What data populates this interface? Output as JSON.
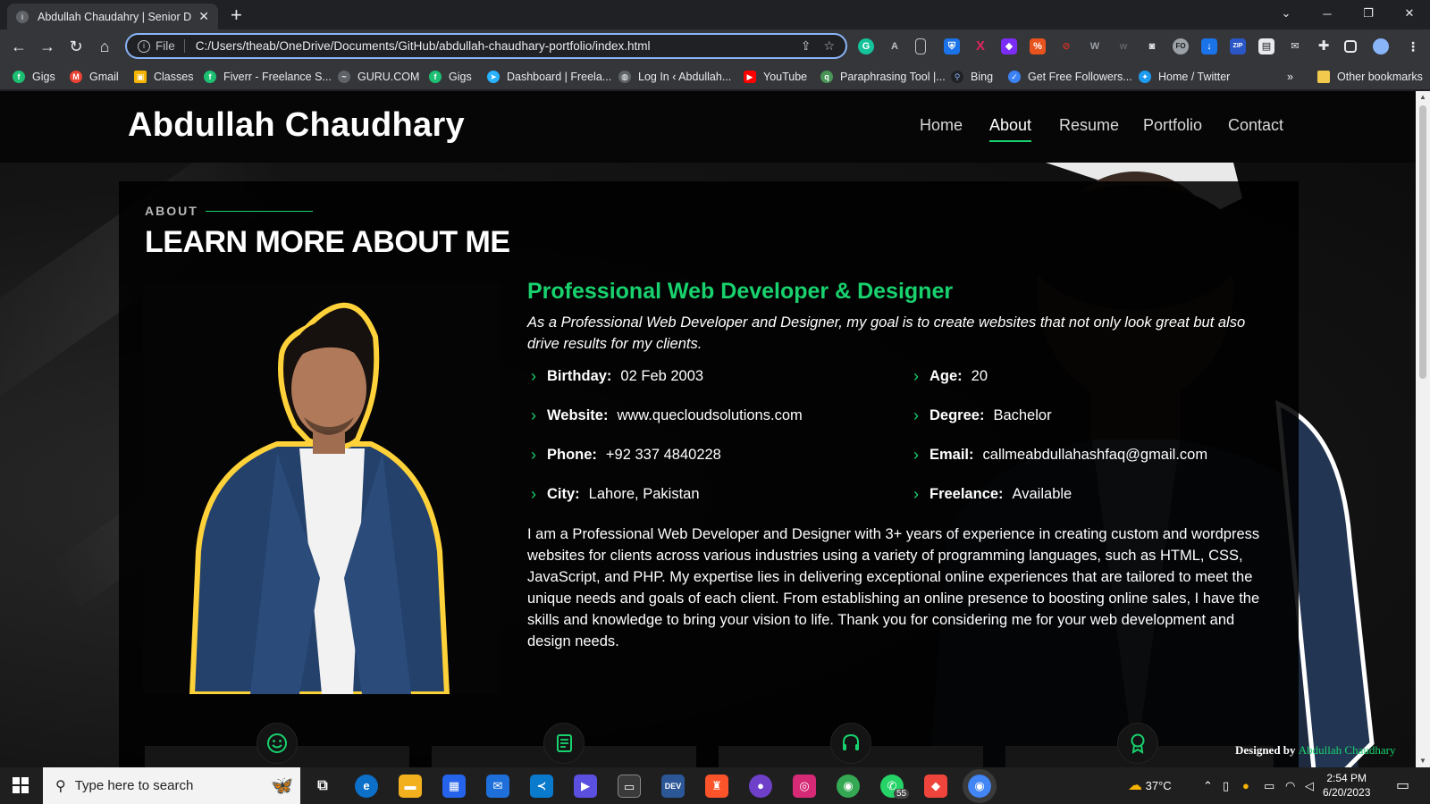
{
  "browser": {
    "tab_title": "Abdullah Chaudahry | Senior Dev",
    "address_scheme": "File",
    "address_url": "C:/Users/theab/OneDrive/Documents/GitHub/abdullah-chaudhary-portfolio/index.html",
    "bookmarks": [
      {
        "label": "Gigs",
        "icon": "fiverr-icon",
        "color": "#1dbf73"
      },
      {
        "label": "Gmail",
        "icon": "gmail-icon",
        "color": "#ea4335"
      },
      {
        "label": "Classes",
        "icon": "classroom-icon",
        "color": "#f4b400"
      },
      {
        "label": "Fiverr - Freelance S...",
        "icon": "fiverr-icon",
        "color": "#1dbf73"
      },
      {
        "label": "GURU.COM",
        "icon": "guru-icon",
        "color": "#5f6368"
      },
      {
        "label": "Gigs",
        "icon": "fiverr-icon",
        "color": "#1dbf73"
      },
      {
        "label": "Dashboard | Freela...",
        "icon": "freelancer-icon",
        "color": "#29b2fe"
      },
      {
        "label": "Log In ‹ Abdullah...",
        "icon": "wordpress-icon",
        "color": "#5f6368"
      },
      {
        "label": "YouTube",
        "icon": "youtube-icon",
        "color": "#ff0000"
      },
      {
        "label": "Paraphrasing Tool |...",
        "icon": "quillbot-icon",
        "color": "#499557"
      },
      {
        "label": "Bing",
        "icon": "bing-search-icon",
        "color": "#202124"
      },
      {
        "label": "Get Free Followers...",
        "icon": "followers-icon",
        "color": "#3b82f6"
      },
      {
        "label": "Home / Twitter",
        "icon": "twitter-icon",
        "color": "#1d9bf0"
      }
    ],
    "other_bookmarks": "Other bookmarks",
    "overflow": "»"
  },
  "site": {
    "logo": "Abdullah Chaudhary",
    "nav": [
      {
        "label": "Home",
        "active": false
      },
      {
        "label": "About",
        "active": true
      },
      {
        "label": "Resume",
        "active": false
      },
      {
        "label": "Portfolio",
        "active": false
      },
      {
        "label": "Contact",
        "active": false
      }
    ],
    "section_label": "ABOUT",
    "section_title": "LEARN MORE ABOUT ME",
    "role": "Professional Web Developer & Designer",
    "intro": "As a Professional Web Developer and Designer, my goal is to create websites that not only look great but also drive results for my clients.",
    "info": [
      {
        "label": "Birthday:",
        "value": "02 Feb 2003"
      },
      {
        "label": "Age:",
        "value": "20"
      },
      {
        "label": "Website:",
        "value": "www.quecloudsolutions.com"
      },
      {
        "label": "Degree:",
        "value": "Bachelor"
      },
      {
        "label": "Phone:",
        "value": "+92 337 4840228"
      },
      {
        "label": "Email:",
        "value": "callmeabdullahashfaq@gmail.com"
      },
      {
        "label": "City:",
        "value": "Lahore, Pakistan"
      },
      {
        "label": "Freelance:",
        "value": "Available"
      }
    ],
    "bio": "I am a Professional Web Developer and Designer with 3+ years of experience in creating custom and wordpress websites for clients across various industries using a variety of programming languages, such as HTML, CSS, JavaScript, and PHP. My expertise lies in delivering exceptional online experiences that are tailored to meet the unique needs and goals of each client. From establishing an online presence to boosting online sales, I have the skills and knowledge to bring your vision to life. Thank you for considering me for your web development and design needs.",
    "stat_icons": [
      "smiley-icon",
      "journal-icon",
      "headset-icon",
      "award-icon"
    ],
    "credit_prefix": "Designed by",
    "credit_name": "Abdullah Chaudhary",
    "accent": "#18d26e",
    "outline": "#ffd23a"
  },
  "taskbar": {
    "search_placeholder": "Type here to search",
    "weather": "37°C",
    "time": "2:54 PM",
    "date": "6/20/2023",
    "whatsapp_badge": "55",
    "apps": [
      {
        "icon": "task-view-icon",
        "color": "#1f1f1f"
      },
      {
        "icon": "edge-icon",
        "color": "#0c6fc8"
      },
      {
        "icon": "file-explorer-icon",
        "color": "#f2b01e"
      },
      {
        "icon": "store-icon",
        "color": "#2563eb"
      },
      {
        "icon": "mail-icon",
        "color": "#1e6fd9"
      },
      {
        "icon": "vscode-icon",
        "color": "#0a7acc"
      },
      {
        "icon": "power-automate-icon",
        "color": "#5b4fe0"
      },
      {
        "icon": "terminal-icon",
        "color": "#3a3a3a"
      },
      {
        "icon": "devtoys-icon",
        "color": "#2b5797"
      },
      {
        "icon": "brave-icon",
        "color": "#fb542b"
      },
      {
        "icon": "github-icon",
        "color": "#6e40c9"
      },
      {
        "icon": "instagram-icon",
        "color": "#d62976"
      },
      {
        "icon": "chrome-icon",
        "color": "#34a853"
      },
      {
        "icon": "whatsapp-icon",
        "color": "#25d366"
      },
      {
        "icon": "anydesk-icon",
        "color": "#ef443b"
      },
      {
        "icon": "chrome-profile-icon",
        "color": "#4285f4"
      }
    ]
  }
}
